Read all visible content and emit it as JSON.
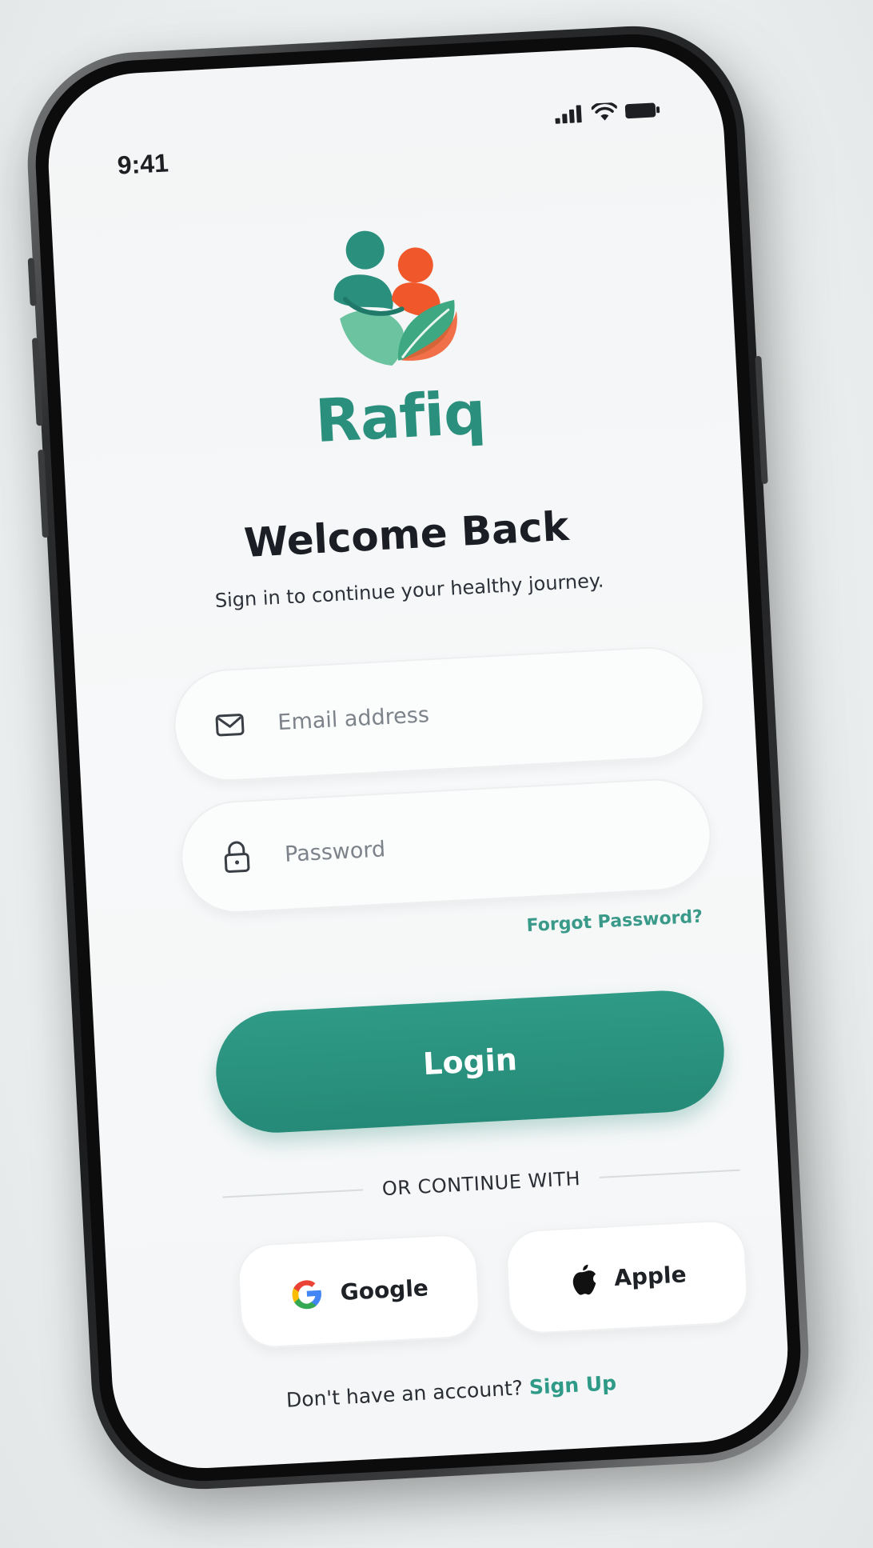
{
  "status_bar": {
    "time": "9:41"
  },
  "brand": {
    "name": "Rafiq"
  },
  "header": {
    "title": "Welcome Back",
    "subtitle": "Sign in to continue your healthy journey."
  },
  "form": {
    "email_placeholder": "Email address",
    "email_value": "",
    "password_placeholder": "Password",
    "password_value": "",
    "forgot_label": "Forgot Password?",
    "login_label": "Login"
  },
  "divider": {
    "label": "OR CONTINUE WITH"
  },
  "social": {
    "google_label": "Google",
    "apple_label": "Apple"
  },
  "footer": {
    "prompt": "Don't have an account?",
    "signup_label": "Sign Up"
  },
  "colors": {
    "primary": "#2a8f7d",
    "accent_orange": "#f0582c",
    "leaf_light": "#6cc3a0",
    "background": "#f5f7f8",
    "text_dark": "#1b1e24"
  },
  "icons": {
    "status": [
      "signal-icon",
      "wifi-icon",
      "battery-icon"
    ],
    "email_field": "envelope-icon",
    "password_field": "lock-icon",
    "google": "google-icon",
    "apple": "apple-icon",
    "brand": "rafiq-logo"
  }
}
